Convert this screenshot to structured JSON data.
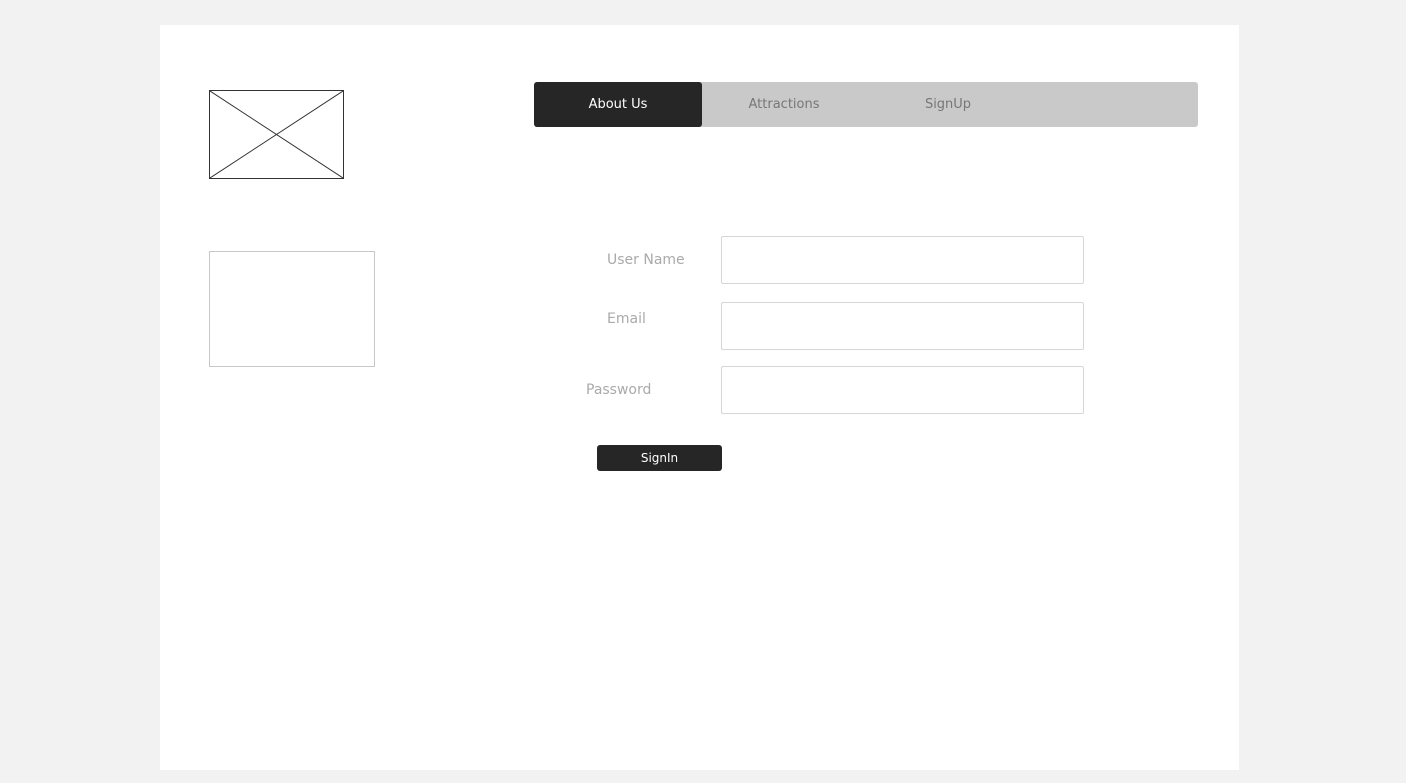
{
  "nav": {
    "items": [
      {
        "label": "About Us",
        "active": true
      },
      {
        "label": "Attractions",
        "active": false
      },
      {
        "label": "SignUp",
        "active": false
      }
    ]
  },
  "form": {
    "username_label": "User Name",
    "username_value": "",
    "email_label": "Email",
    "email_value": "",
    "password_label": "Password",
    "password_value": "",
    "signin_label": "SignIn"
  },
  "icons": {
    "logo": "image-placeholder-icon"
  },
  "colors": {
    "background": "#f2f2f2",
    "canvas": "#ffffff",
    "nav_bar": "#c9c9c9",
    "nav_active": "#262626",
    "button": "#262626",
    "label_text": "#aaaaaa"
  }
}
